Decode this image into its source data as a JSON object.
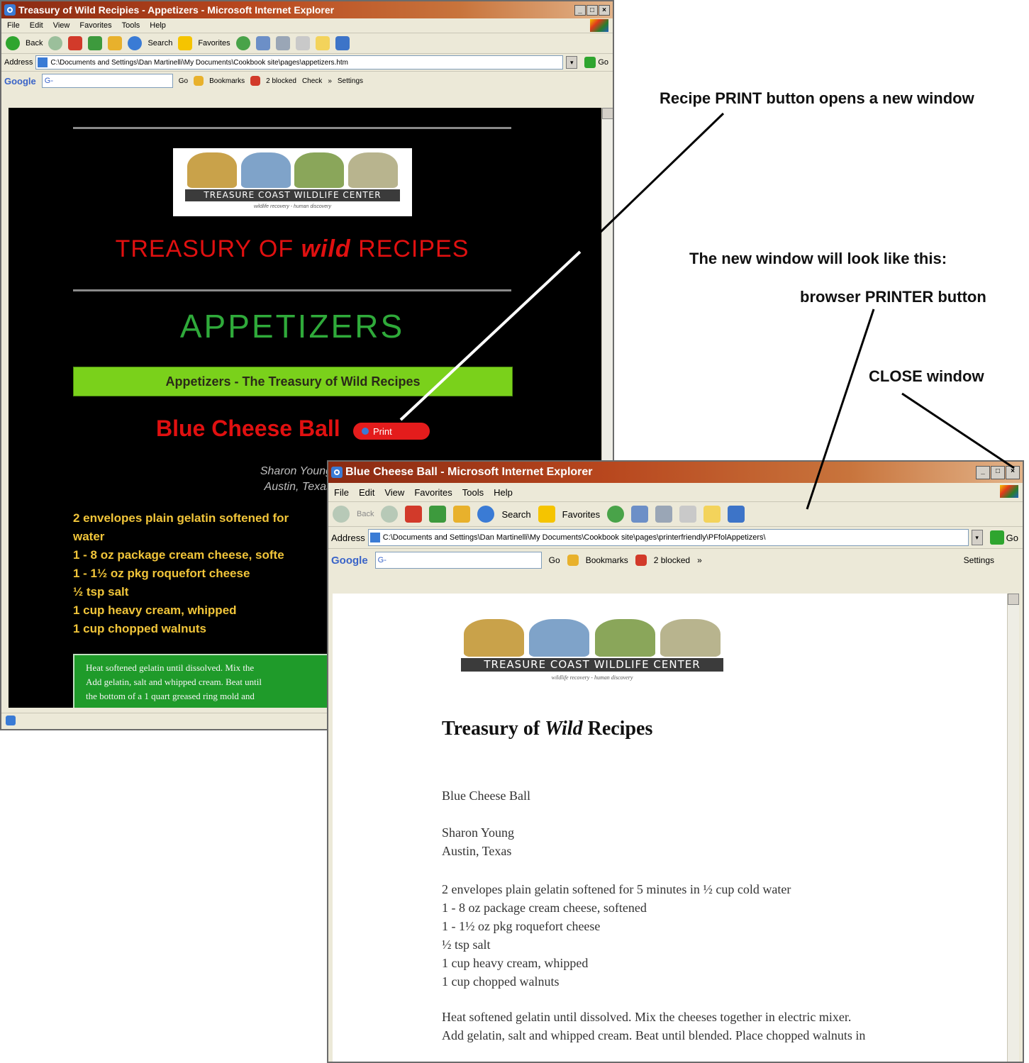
{
  "window1": {
    "title": "Treasury of Wild Recipies - Appetizers - Microsoft Internet Explorer",
    "menu": [
      "File",
      "Edit",
      "View",
      "Favorites",
      "Tools",
      "Help"
    ],
    "toolbar": {
      "back": "Back",
      "search": "Search",
      "favorites": "Favorites"
    },
    "address_label": "Address",
    "address": "C:\\Documents and Settings\\Dan Martinelli\\My Documents\\Cookbook site\\pages\\appetizers.htm",
    "go": "Go",
    "google": {
      "logo": "Google",
      "field": "G-",
      "go": "Go",
      "bookmarks": "Bookmarks",
      "blocked": "2 blocked",
      "check": "Check",
      "more": "»",
      "settings": "Settings"
    },
    "logo_name": "TREASURE COAST WILDLIFE CENTER",
    "logo_tag": "wildlife recovery - human discovery",
    "recipes_title_pre": "TREASURY OF ",
    "recipes_title_wild": "wild",
    "recipes_title_post": " RECIPES",
    "section": "APPETIZERS",
    "banner": "Appetizers - The Treasury of Wild Recipes",
    "dish": "Blue Cheese Ball",
    "print_label": "Print",
    "author": "Sharon Young",
    "location": "Austin, Texas",
    "ingredients": [
      "2 envelopes plain gelatin softened for",
      "water",
      "1 - 8 oz package cream cheese, softe",
      "1 - 1½ oz pkg roquefort cheese",
      "½ tsp salt",
      "1 cup heavy cream, whipped",
      "1 cup chopped walnuts"
    ],
    "method": [
      "Heat softened gelatin until dissolved. Mix the",
      "Add gelatin, salt and whipped cream. Beat until",
      "the bottom of a 1 quart greased ring mold and"
    ]
  },
  "window2": {
    "title": "Blue Cheese Ball - Microsoft Internet Explorer",
    "menu": [
      "File",
      "Edit",
      "View",
      "Favorites",
      "Tools",
      "Help"
    ],
    "toolbar": {
      "back": "Back",
      "search": "Search",
      "favorites": "Favorites"
    },
    "address_label": "Address",
    "address": "C:\\Documents and Settings\\Dan Martinelli\\My Documents\\Cookbook site\\pages\\printerfriendly\\PFfolAppetizers\\",
    "go": "Go",
    "google": {
      "logo": "Google",
      "field": "G-",
      "go": "Go",
      "bookmarks": "Bookmarks",
      "blocked": "2 blocked",
      "more": "»",
      "settings": "Settings"
    },
    "logo_name": "TREASURE COAST WILDLIFE CENTER",
    "logo_tag": "wildlife recovery - human discovery",
    "heading_pre": "Treasury of ",
    "heading_wild": "Wild",
    "heading_post": " Recipes",
    "dish": "Blue Cheese Ball",
    "author": "Sharon Young",
    "location": "Austin, Texas",
    "ingredients": [
      "2 envelopes plain gelatin softened for 5 minutes in ½ cup cold water",
      "1 - 8 oz package cream cheese, softened",
      "1 - 1½ oz pkg roquefort cheese",
      "½ tsp salt",
      "1 cup heavy cream, whipped",
      "1 cup chopped walnuts"
    ],
    "method": [
      "Heat softened gelatin until dissolved. Mix the cheeses together in electric mixer.",
      "Add gelatin, salt and whipped cream. Beat until blended. Place chopped walnuts in"
    ]
  },
  "callouts": {
    "print_button": "Recipe PRINT button opens a new window",
    "new_window": "The new window will look like this:",
    "printer_button": "browser PRINTER button",
    "close_window": "CLOSE window"
  },
  "colors": {
    "title_red": "#e01010",
    "appetizers_green": "#2faa3a",
    "banner_green": "#7ad11b",
    "ingredient_gold": "#f1c53a"
  }
}
